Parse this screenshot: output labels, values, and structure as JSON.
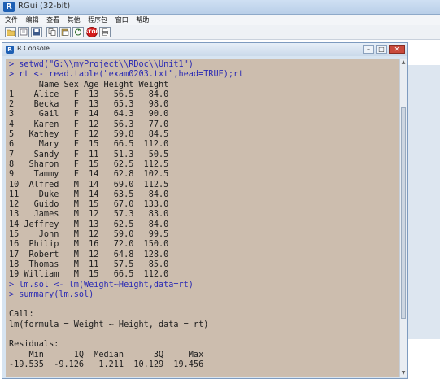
{
  "app": {
    "title": "RGui (32-bit)",
    "logo_text": "R"
  },
  "menu": [
    "文件",
    "编辑",
    "查看",
    "其他",
    "程序包",
    "窗口",
    "帮助"
  ],
  "toolbar": {
    "icons": [
      "open-script-icon",
      "load-workspace-icon",
      "save-workspace-icon",
      "copy-icon",
      "paste-icon",
      "copy-paste-icon",
      "stop-icon",
      "print-icon"
    ],
    "stop_label": "STOP"
  },
  "console_window": {
    "title": "R Console",
    "logo_text": "R",
    "min_label": "–",
    "max_label": "□",
    "close_label": "✕"
  },
  "console_lines": [
    {
      "type": "cmd",
      "text": "> setwd(\"G:\\\\myProject\\\\RDoc\\\\Unit1\")"
    },
    {
      "type": "cmd",
      "text": "> rt <- read.table(\"exam0203.txt\",head=TRUE);rt"
    },
    {
      "type": "out",
      "text": "      Name Sex Age Height Weight"
    },
    {
      "type": "out",
      "text": "1    Alice   F  13   56.5   84.0"
    },
    {
      "type": "out",
      "text": "2    Becka   F  13   65.3   98.0"
    },
    {
      "type": "out",
      "text": "3     Gail   F  14   64.3   90.0"
    },
    {
      "type": "out",
      "text": "4    Karen   F  12   56.3   77.0"
    },
    {
      "type": "out",
      "text": "5   Kathey   F  12   59.8   84.5"
    },
    {
      "type": "out",
      "text": "6     Mary   F  15   66.5  112.0"
    },
    {
      "type": "out",
      "text": "7    Sandy   F  11   51.3   50.5"
    },
    {
      "type": "out",
      "text": "8   Sharon   F  15   62.5  112.5"
    },
    {
      "type": "out",
      "text": "9    Tammy   F  14   62.8  102.5"
    },
    {
      "type": "out",
      "text": "10  Alfred   M  14   69.0  112.5"
    },
    {
      "type": "out",
      "text": "11    Duke   M  14   63.5   84.0"
    },
    {
      "type": "out",
      "text": "12   Guido   M  15   67.0  133.0"
    },
    {
      "type": "out",
      "text": "13   James   M  12   57.3   83.0"
    },
    {
      "type": "out",
      "text": "14 Jeffrey   M  13   62.5   84.0"
    },
    {
      "type": "out",
      "text": "15    John   M  12   59.0   99.5"
    },
    {
      "type": "out",
      "text": "16  Philip   M  16   72.0  150.0"
    },
    {
      "type": "out",
      "text": "17  Robert   M  12   64.8  128.0"
    },
    {
      "type": "out",
      "text": "18  Thomas   M  11   57.5   85.0"
    },
    {
      "type": "out",
      "text": "19 William   M  15   66.5  112.0"
    },
    {
      "type": "cmd",
      "text": "> lm.sol <- lm(Weight~Height,data=rt)"
    },
    {
      "type": "cmd",
      "text": "> summary(lm.sol)"
    },
    {
      "type": "out",
      "text": ""
    },
    {
      "type": "out",
      "text": "Call:"
    },
    {
      "type": "out",
      "text": "lm(formula = Weight ~ Height, data = rt)"
    },
    {
      "type": "out",
      "text": ""
    },
    {
      "type": "out",
      "text": "Residuals:"
    },
    {
      "type": "out",
      "text": "    Min      1Q  Median      3Q     Max "
    },
    {
      "type": "out",
      "text": "-19.535  -9.126   1.211  10.129  19.456 "
    }
  ],
  "colors": {
    "console_bg": "#ccbdae",
    "command_text": "#2a2ab4",
    "output_text": "#1d1d1d"
  }
}
